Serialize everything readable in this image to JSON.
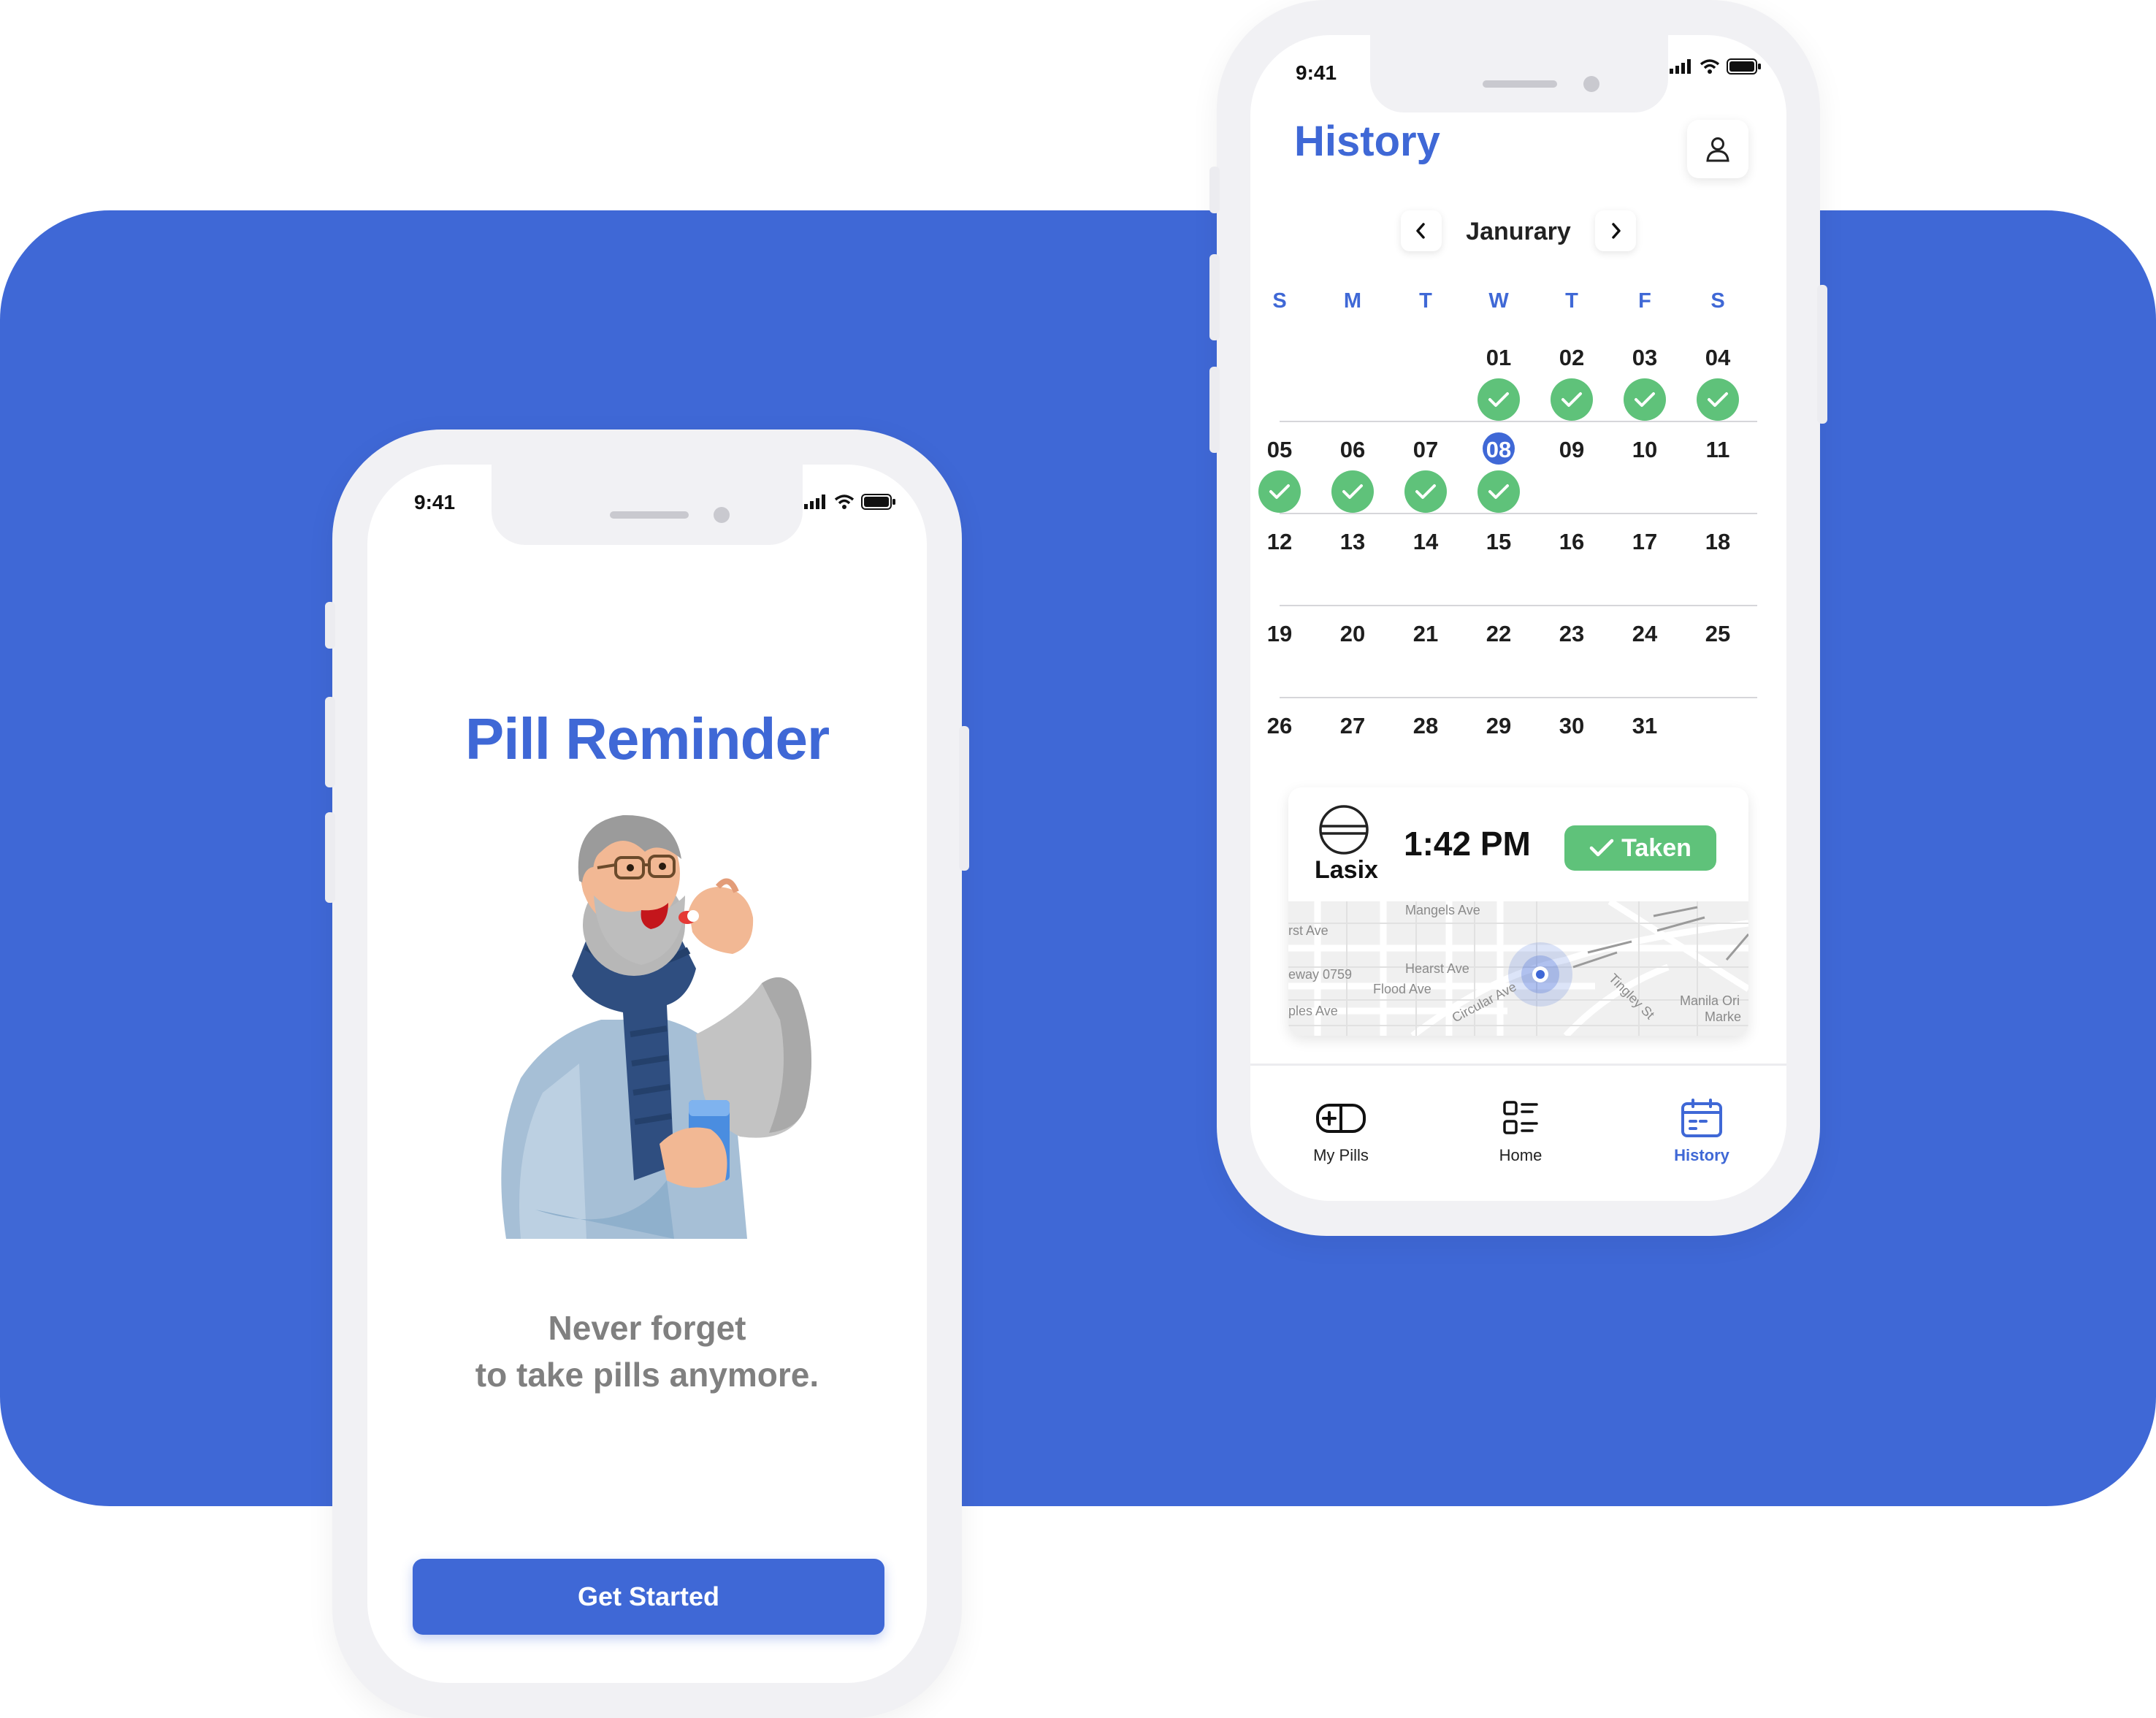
{
  "colors": {
    "accent": "#3f68d6",
    "taken_green": "#5fc27a",
    "tagline_gray": "#808080"
  },
  "welcome_screen": {
    "status_time": "9:41",
    "title": "Pill Reminder",
    "tagline_line1": "Never forget",
    "tagline_line2": "to take pills anymore.",
    "cta_label": "Get Started",
    "illustration": "elderly-man-taking-pill-illustration"
  },
  "history_screen": {
    "status_time": "9:41",
    "title": "History",
    "profile_icon": "user-icon",
    "month": "Janurary",
    "weekdays": [
      "S",
      "M",
      "T",
      "W",
      "T",
      "F",
      "S"
    ],
    "weeks": [
      [
        "",
        "",
        "",
        "01",
        "02",
        "03",
        "04"
      ],
      [
        "05",
        "06",
        "07",
        "08",
        "09",
        "10",
        "11"
      ],
      [
        "12",
        "13",
        "14",
        "15",
        "16",
        "17",
        "18"
      ],
      [
        "19",
        "20",
        "21",
        "22",
        "23",
        "24",
        "25"
      ],
      [
        "26",
        "27",
        "28",
        "29",
        "30",
        "31",
        ""
      ]
    ],
    "selected_day": "08",
    "taken_days": [
      "01",
      "02",
      "03",
      "04",
      "05",
      "06",
      "07",
      "08"
    ],
    "dose": {
      "pill_name": "Lasix",
      "time": "1:42 PM",
      "status": "Taken",
      "map_labels": [
        "Mangels Ave",
        "rst Ave",
        "eway 0759",
        "Hearst Ave",
        "Flood Ave",
        "ples Ave",
        "Circular Ave",
        "Tingley St",
        "Manila Ori",
        "Marke"
      ]
    },
    "tabs": [
      {
        "label": "My Pills",
        "icon": "pill-box-icon",
        "active": false
      },
      {
        "label": "Home",
        "icon": "list-icon",
        "active": false
      },
      {
        "label": "History",
        "icon": "calendar-icon",
        "active": true
      }
    ]
  }
}
